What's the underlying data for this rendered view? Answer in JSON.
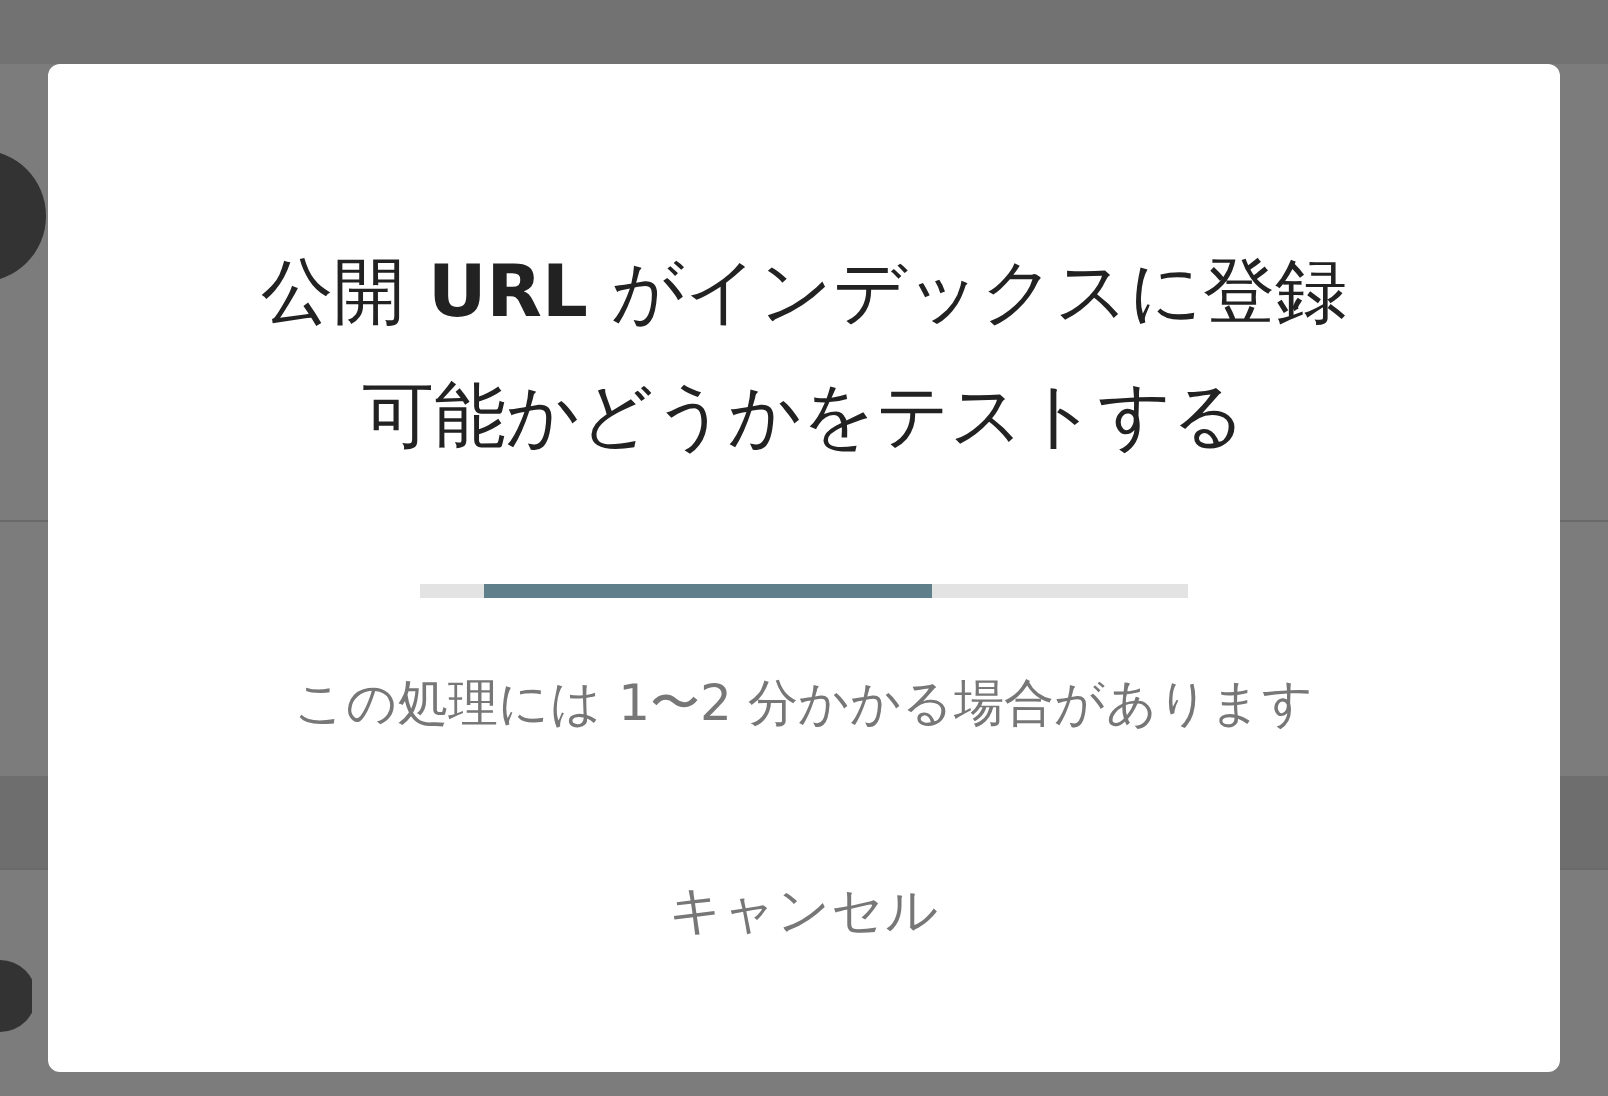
{
  "dialog": {
    "title": "公開 **URL** がインデックスに登録可能かどうかをテストする",
    "message": "この処理には 1〜2 分かかる場合があります",
    "cancel_button": "キャンセル"
  }
}
